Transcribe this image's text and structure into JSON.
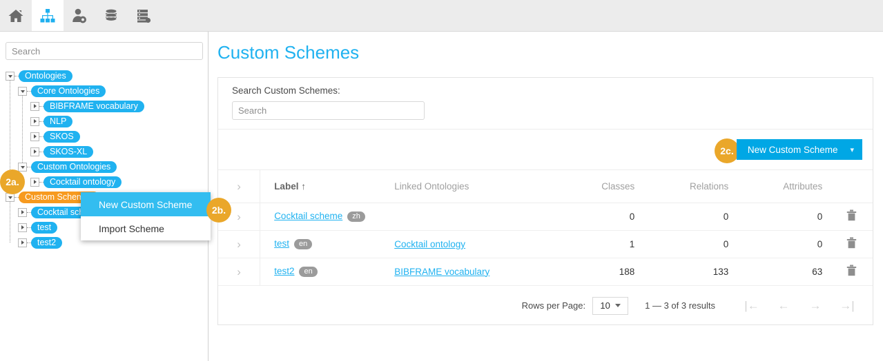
{
  "toolbar": {
    "buttons": [
      {
        "name": "home-icon",
        "label": "Home",
        "active": false
      },
      {
        "name": "hierarchy-icon",
        "label": "Ontologies",
        "active": true
      },
      {
        "name": "user-settings-icon",
        "label": "Users",
        "active": false
      },
      {
        "name": "database-icon",
        "label": "Data",
        "active": false
      },
      {
        "name": "server-export-icon",
        "label": "Server",
        "active": false
      }
    ]
  },
  "sidebar": {
    "search": {
      "placeholder": "Search",
      "value": ""
    },
    "tree": [
      {
        "label": "Ontologies",
        "depth": 0,
        "state": "open",
        "highlight": false
      },
      {
        "label": "Core Ontologies",
        "depth": 1,
        "state": "open",
        "highlight": false
      },
      {
        "label": "BIBFRAME vocabulary",
        "depth": 2,
        "state": "closed",
        "highlight": false
      },
      {
        "label": "NLP",
        "depth": 2,
        "state": "closed",
        "highlight": false
      },
      {
        "label": "SKOS",
        "depth": 2,
        "state": "closed",
        "highlight": false
      },
      {
        "label": "SKOS-XL",
        "depth": 2,
        "state": "closed",
        "highlight": false
      },
      {
        "label": "Custom Ontologies",
        "depth": 1,
        "state": "open",
        "highlight": false
      },
      {
        "label": "Cocktail ontology",
        "depth": 2,
        "state": "closed",
        "highlight": false
      },
      {
        "label": "Custom Schemes",
        "depth": 0,
        "state": "open",
        "highlight": true
      },
      {
        "label": "Cocktail scheme",
        "depth": 1,
        "state": "closed",
        "highlight": false
      },
      {
        "label": "test",
        "depth": 1,
        "state": "closed",
        "highlight": false
      },
      {
        "label": "test2",
        "depth": 1,
        "state": "closed",
        "highlight": false
      }
    ]
  },
  "context_menu": {
    "items": [
      {
        "label": "New Custom Scheme",
        "highlighted": true
      },
      {
        "label": "Import Scheme",
        "highlighted": false
      }
    ]
  },
  "callouts": [
    {
      "id": "2a",
      "label": "2a."
    },
    {
      "id": "2b",
      "label": "2b."
    },
    {
      "id": "2c",
      "label": "2c."
    }
  ],
  "main": {
    "title": "Custom Schemes",
    "search": {
      "label": "Search Custom Schemes:",
      "placeholder": "Search",
      "value": ""
    },
    "new_scheme_button": {
      "label": "New Custom Scheme",
      "caret": "chevron-down-icon"
    },
    "table": {
      "columns": [
        {
          "key": "expand",
          "label": "",
          "sorted": false
        },
        {
          "key": "label",
          "label": "Label",
          "sorted": true,
          "sort_arrow": "↑"
        },
        {
          "key": "linked",
          "label": "Linked Ontologies",
          "sorted": false
        },
        {
          "key": "classes",
          "label": "Classes",
          "sorted": false
        },
        {
          "key": "relations",
          "label": "Relations",
          "sorted": false
        },
        {
          "key": "attributes",
          "label": "Attributes",
          "sorted": false
        },
        {
          "key": "delete",
          "label": "",
          "sorted": false
        }
      ],
      "rows": [
        {
          "label": "Cocktail scheme",
          "lang": "zh",
          "linked": "",
          "classes": "0",
          "relations": "0",
          "attributes": "0"
        },
        {
          "label": "test",
          "lang": "en",
          "linked": "Cocktail ontology",
          "classes": "1",
          "relations": "0",
          "attributes": "0"
        },
        {
          "label": "test2",
          "lang": "en",
          "linked": "BIBFRAME vocabulary",
          "classes": "188",
          "relations": "133",
          "attributes": "63"
        }
      ]
    },
    "paginator": {
      "rows_per_page_label": "Rows per Page:",
      "rows_per_page_value": "10",
      "range_label": "1 — 3 of 3 results",
      "first_label": "|←",
      "prev_label": "←",
      "next_label": "→",
      "last_label": "→|"
    }
  },
  "colors": {
    "accent_blue": "#20b2f0",
    "button_blue": "#00a7e5",
    "highlight_orange": "#f79a1e",
    "callout_orange": "#eaa72a",
    "toolbar_bg": "#ececec",
    "lang_badge_gray": "#9b9b9b"
  }
}
